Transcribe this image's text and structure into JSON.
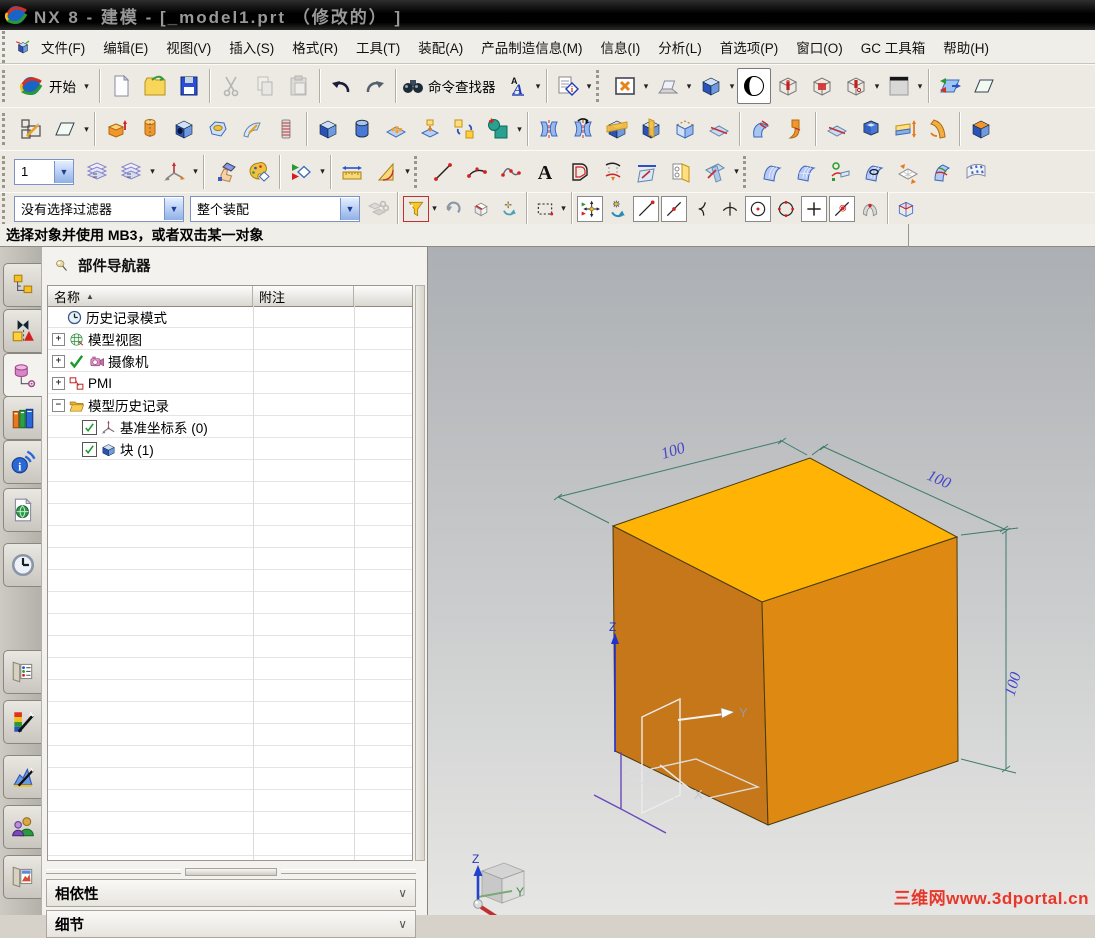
{
  "title_bar": {
    "title": "NX 8  -  建模  -  [_model1.prt  （修改的）  ]"
  },
  "menu_bar": {
    "items": [
      "文件(F)",
      "编辑(E)",
      "视图(V)",
      "插入(S)",
      "格式(R)",
      "工具(T)",
      "装配(A)",
      "产品制造信息(M)",
      "信息(I)",
      "分析(L)",
      "首选项(P)",
      "窗口(O)",
      "GC 工具箱",
      "帮助(H)"
    ]
  },
  "toolbars": {
    "row1": {
      "start_label": "开始",
      "command_finder_label": "命令查找器",
      "icons": [
        "start",
        "new",
        "open",
        "save",
        "cut",
        "copy",
        "paste",
        "undo",
        "redo",
        "command-finder",
        "annotation-font",
        "information-note",
        "window-layout",
        "sketch-viewer",
        "shaded-view",
        "render-style",
        "section-cylinder",
        "section-cube",
        "section-edit",
        "background-plain",
        "clip-section"
      ]
    },
    "row2": {
      "icons": [
        "sketch",
        "sketch-in-task",
        "extrude",
        "revolve",
        "hole",
        "boss",
        "rib",
        "thread",
        "block",
        "cylinder",
        "pattern-feature",
        "emboss",
        "move-face",
        "unite",
        "mirror-feature",
        "mirror-body",
        "trim-body",
        "split-body",
        "trimmed-sheet",
        "sew",
        "sweep",
        "flange",
        "offset-sheet",
        "shell",
        "sheet-stretch",
        "sheet-bend",
        "offset-face"
      ]
    },
    "row3": {
      "layer_value": "1",
      "icons": [
        "layer-settings",
        "layer-visible-in-view",
        "wcs-orientation",
        "object-display",
        "role-palette",
        "show-hide",
        "measure-distance",
        "measure-angle",
        "line",
        "arc",
        "spline",
        "text",
        "offset-curve",
        "project-curve",
        "datum-plane",
        "section-curve",
        "intersection-curve",
        "ruled-surface",
        "through-curves",
        "point-on-surface",
        "bounded-plane",
        "studio-surface",
        "section-surface",
        "flag-surface"
      ]
    }
  },
  "selection_bar": {
    "filter_value": "没有选择过滤器",
    "scope_value": "整个装配",
    "icons": [
      "assembly-select",
      "snap-filter",
      "rollback",
      "deselect",
      "rotate-point",
      "rectangle-select",
      "snap-enable",
      "snap-orient",
      "endpoint",
      "midpoint",
      "curve-point",
      "intersection-point",
      "arc-center",
      "quadrant-point",
      "existing-point",
      "point-on-curve",
      "point-on-face",
      "bounded-grid"
    ]
  },
  "prompt_bar": {
    "message": "选择对象并使用 MB3，或者双击某一对象"
  },
  "sidebar": {
    "items": [
      "assembly-navigator",
      "constraint-navigator",
      "part-navigator",
      "reuse-library",
      "hd3d-tool",
      "web-browser",
      "history",
      "palettes",
      "visualization",
      "scene-visualization",
      "roles",
      "windows"
    ]
  },
  "part_navigator": {
    "title": "部件导航器",
    "columns": {
      "name": "名称",
      "note": "附注"
    },
    "tree": [
      {
        "label": "历史记录模式",
        "icon": "clock"
      },
      {
        "label": "模型视图",
        "icon": "model-views",
        "expander": "+"
      },
      {
        "label": "摄像机",
        "icon": "camera",
        "expander": "+",
        "checked": true
      },
      {
        "label": "PMI",
        "icon": "pmi",
        "expander": "+"
      },
      {
        "label": "模型历史记录",
        "icon": "folder-open",
        "expander": "-"
      },
      {
        "label": "基准坐标系 (0)",
        "icon": "datum-csys",
        "checkbox": true
      },
      {
        "label": "块 (1)",
        "icon": "block",
        "checkbox": true
      }
    ],
    "sections": {
      "dependencies": "相依性",
      "details": "细节"
    }
  },
  "viewport": {
    "dim_labels": [
      "100",
      "100",
      "100"
    ],
    "csys_labels": {
      "z": "Z",
      "y": "Y",
      "x": "X"
    },
    "triad_labels": {
      "z": "Z",
      "y": "Y"
    },
    "watermark": "三维网www.3dportal.cn",
    "colors": {
      "cube_top": "#FFB405",
      "cube_left": "#C5771A",
      "cube_right": "#DE8A12",
      "dimension": "#3E7A6E",
      "dim_text": "#4747C8",
      "watermark": "#E03A2E"
    }
  }
}
